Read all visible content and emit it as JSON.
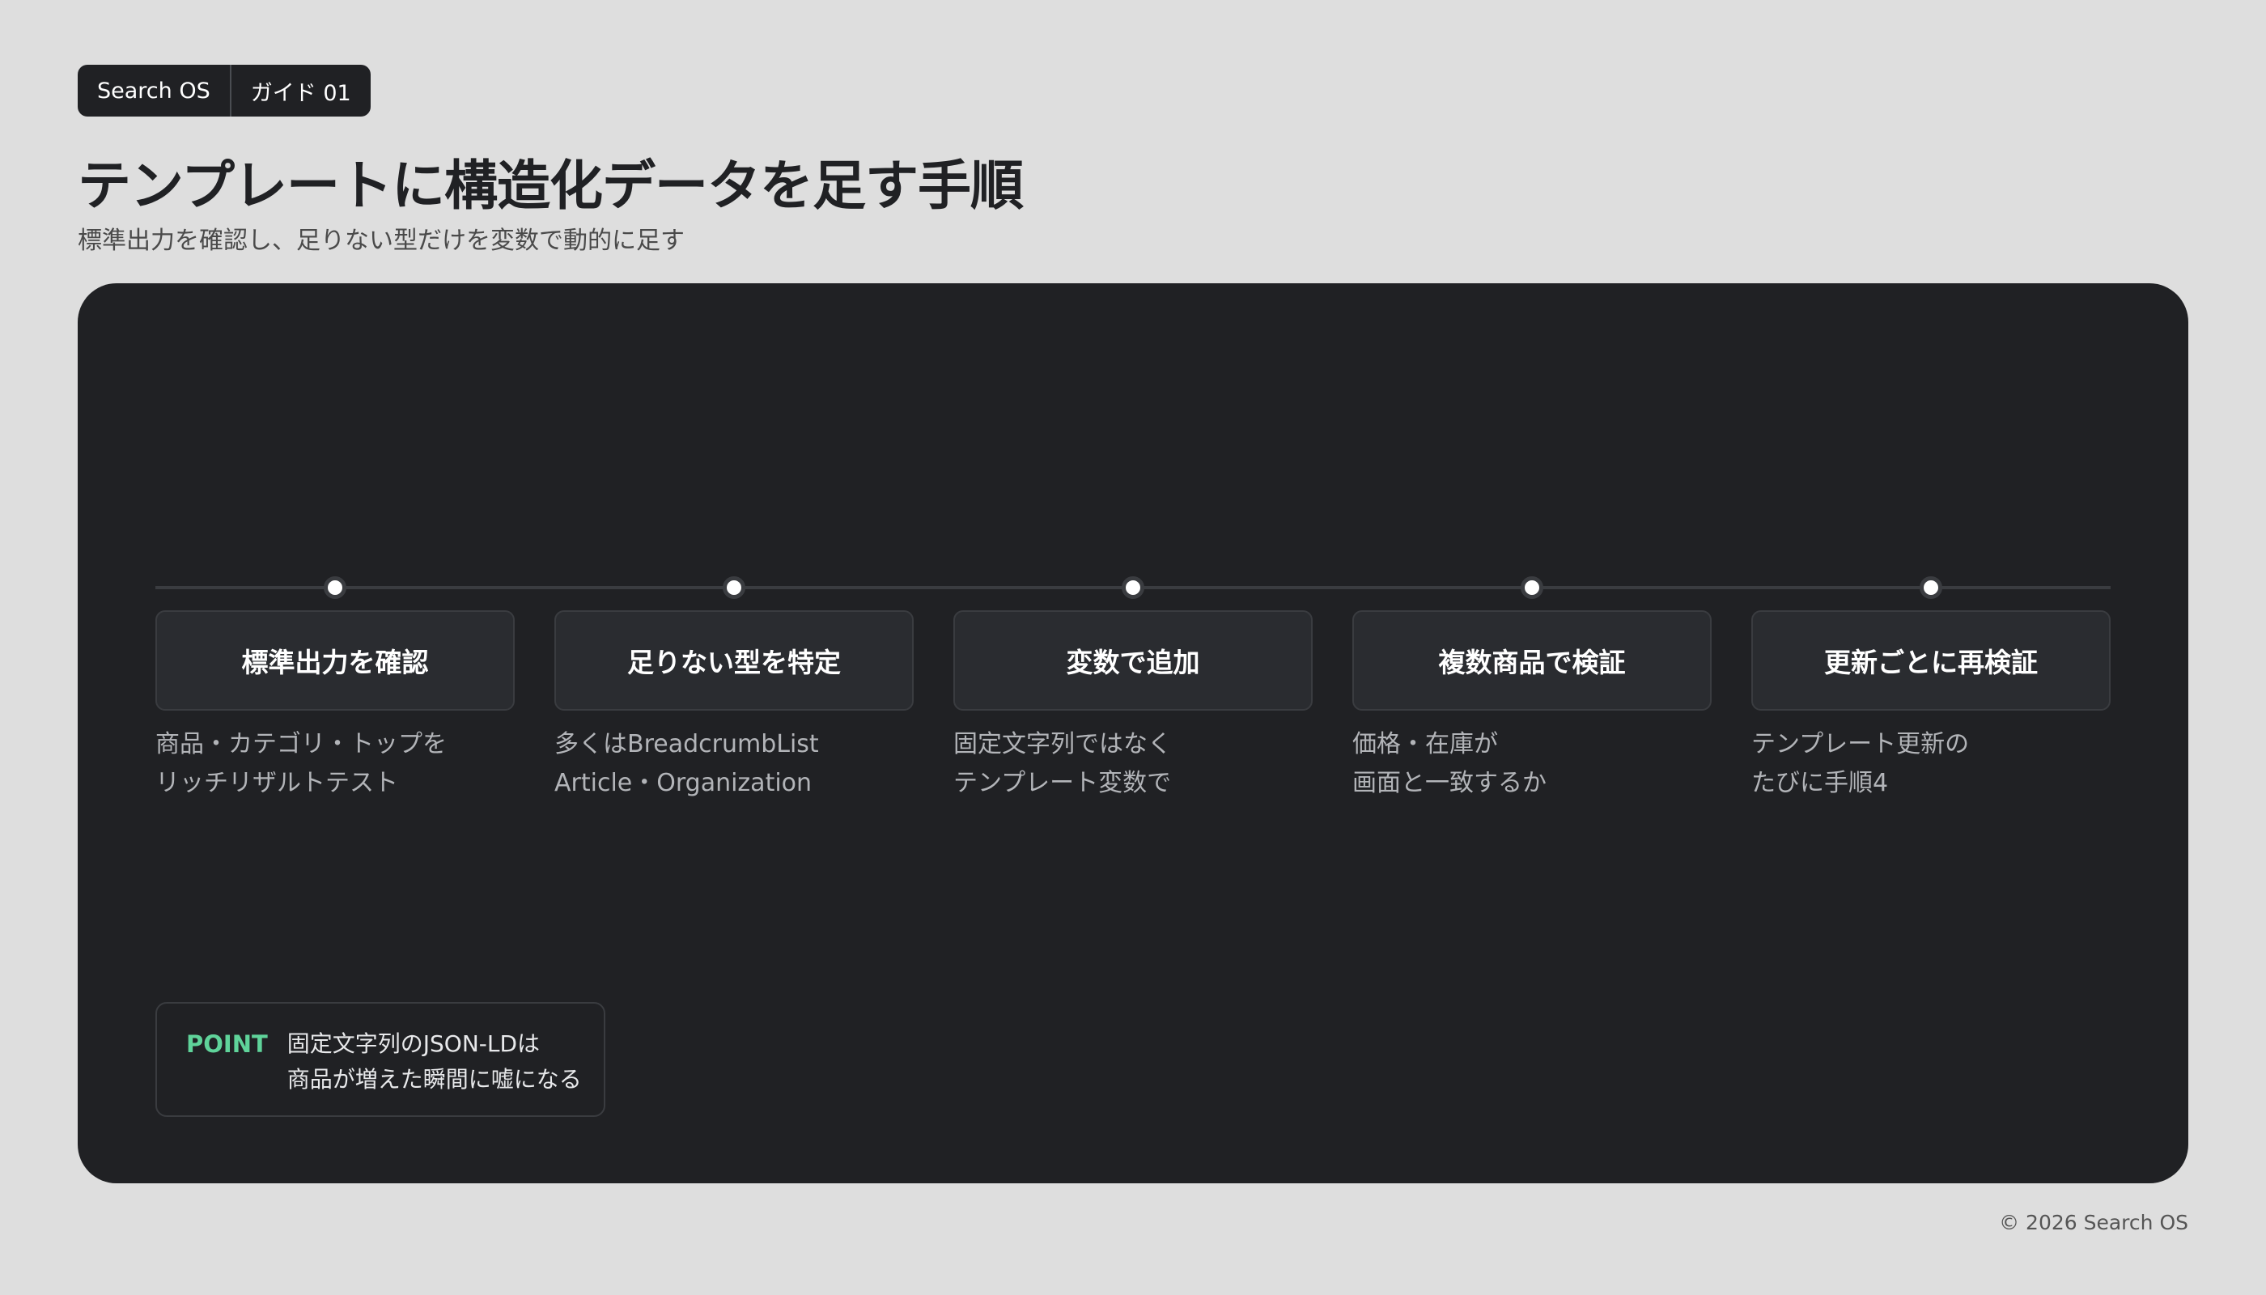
{
  "header": {
    "brand": "Search OS",
    "guide": "ガイド 01",
    "title": "テンプレートに構造化データを足す手順",
    "subtitle": "標準出力を確認し、足りない型だけを変数で動的に足す"
  },
  "steps": [
    {
      "label": "標準出力を確認",
      "desc": [
        "商品・カテゴリ・トップを",
        "リッチリザルトテスト"
      ]
    },
    {
      "label": "足りない型を特定",
      "desc": [
        "多くはBreadcrumbList",
        "Article・Organization"
      ]
    },
    {
      "label": "変数で追加",
      "desc": [
        "固定文字列ではなく",
        "テンプレート変数で"
      ]
    },
    {
      "label": "複数商品で検証",
      "desc": [
        "価格・在庫が",
        "画面と一致するか"
      ]
    },
    {
      "label": "更新ごとに再検証",
      "desc": [
        "テンプレート更新の",
        "たびに手順4"
      ]
    }
  ],
  "point": {
    "label": "POINT",
    "text": [
      "固定文字列のJSON-LDは",
      "商品が増えた瞬間に嘘になる"
    ]
  },
  "footer": {
    "copyright": "© 2026 Search OS"
  },
  "colors": {
    "background": "#dedede",
    "panel": "#202124",
    "accent": "#5fd39a"
  }
}
